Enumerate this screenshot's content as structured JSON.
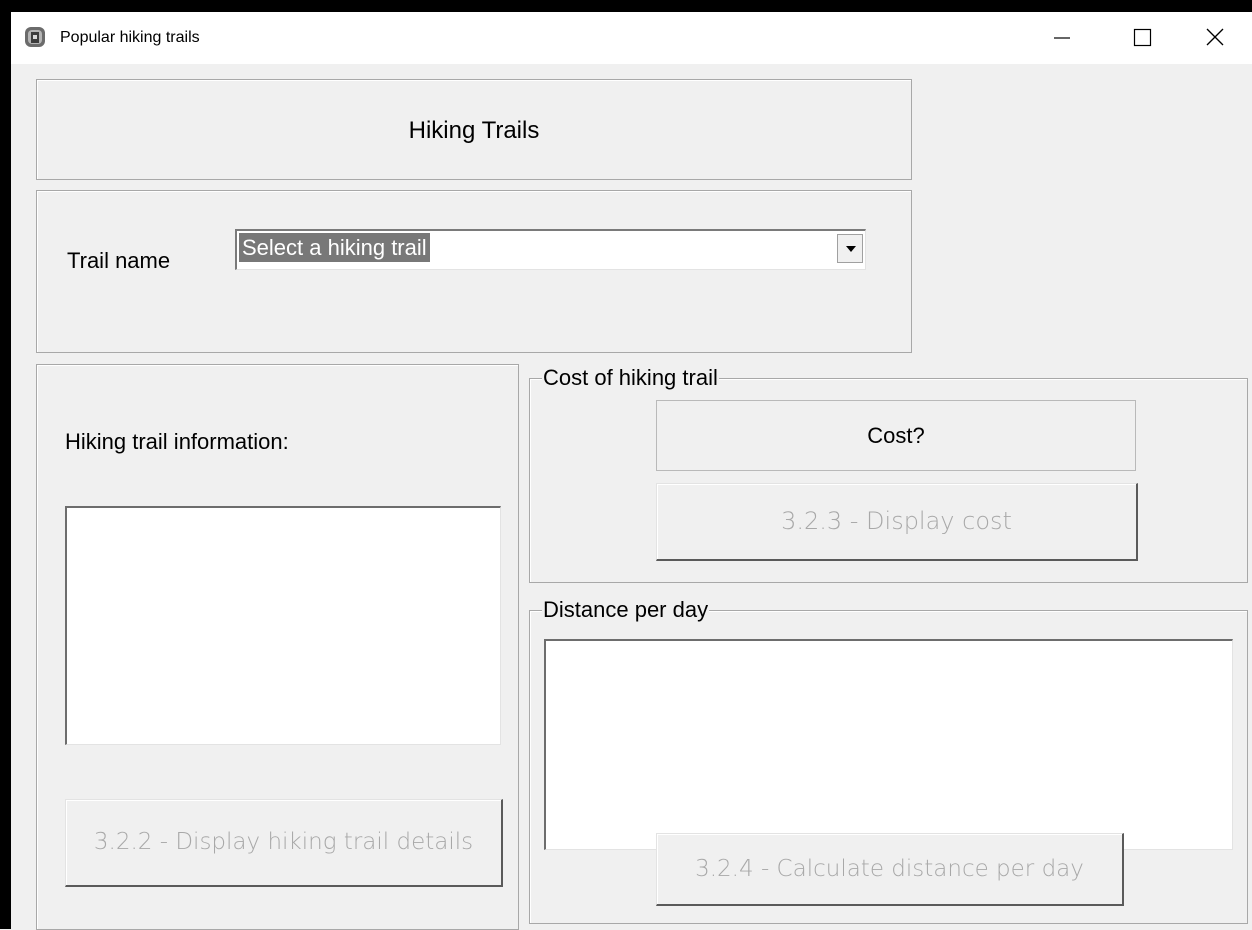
{
  "window": {
    "title": "Popular hiking trails",
    "icon": "app-icon",
    "controls": [
      "minimize-icon",
      "maximize-icon",
      "close-icon"
    ]
  },
  "heading": {
    "text": "Hiking Trails"
  },
  "trail_selector": {
    "label": "Trail name",
    "selected_value": "Select a hiking trail"
  },
  "info_section": {
    "label": "Hiking trail information:",
    "textbox_value": "",
    "button_label": "3.2.2 - Display hiking trail details",
    "button_enabled": false
  },
  "cost_group": {
    "legend": "Cost of hiking trail",
    "result_label": "Cost?",
    "button_label": "3.2.3 - Display cost",
    "button_enabled": false
  },
  "distance_group": {
    "legend": "Distance per day",
    "textbox_value": "",
    "button_label": "3.2.4 - Calculate distance per day",
    "button_enabled": false
  },
  "colors": {
    "window_bg": "#f0f0f0",
    "selection_bg": "#787878",
    "disabled_text": "#a8a8a8"
  }
}
